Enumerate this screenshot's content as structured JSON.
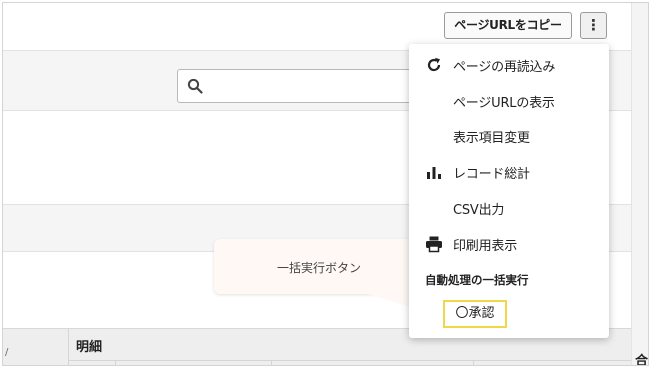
{
  "header": {
    "copy_button_label": "ページURLをコピー",
    "more_button_label": "⋮"
  },
  "search": {
    "value": "",
    "placeholder": ""
  },
  "menu": {
    "items": [
      {
        "label": "ページの再読込み",
        "icon": "refresh-icon"
      },
      {
        "label": "ページURLの表示",
        "icon": ""
      },
      {
        "label": "表示項目変更",
        "icon": ""
      },
      {
        "label": "レコード総計",
        "icon": "bar-chart-icon"
      },
      {
        "label": "CSV出力",
        "icon": ""
      },
      {
        "label": "印刷用表示",
        "icon": "printer-icon"
      }
    ],
    "section_title": "自動処理の一括実行",
    "approve_label": "〇承認",
    "highlight_color": "#f0d84a"
  },
  "tooltip": {
    "text": "一括実行ボタン"
  },
  "table": {
    "header_detail": "明細",
    "header_total": "合",
    "left_tick": "/"
  }
}
